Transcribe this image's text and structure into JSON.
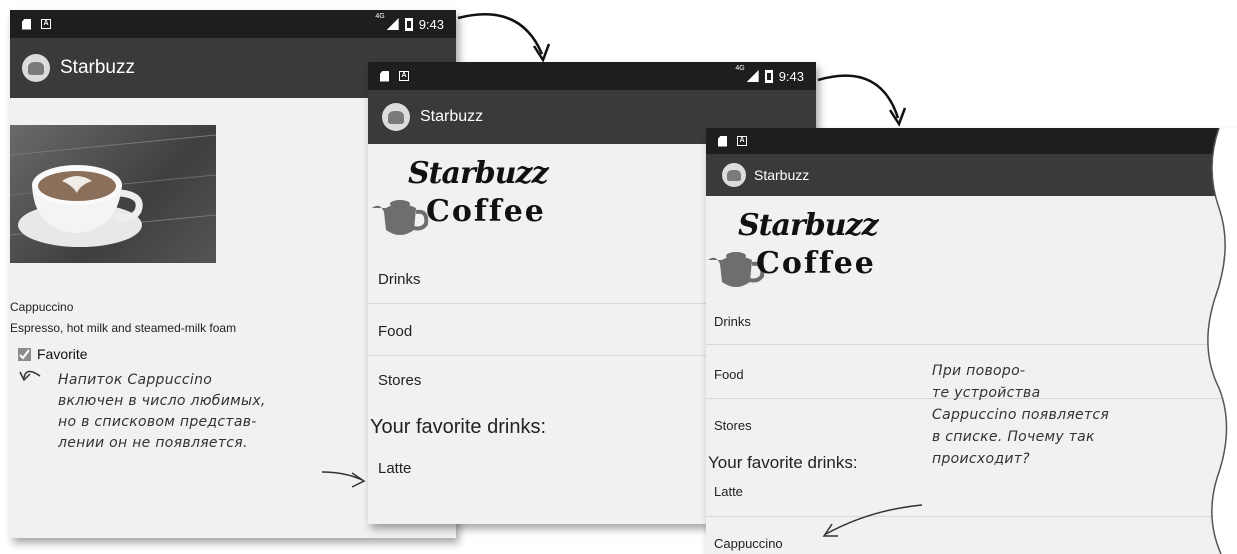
{
  "screens": [
    {
      "status_time": "9:43",
      "network": "4G",
      "app_title": "Starbuzz",
      "drink_name": "Cappuccino",
      "drink_description": "Espresso, hot milk and steamed-milk foam",
      "favorite_label": "Favorite",
      "favorite_checked": true
    },
    {
      "status_time": "9:43",
      "network": "4G",
      "app_title": "Starbuzz",
      "logo_line1": "Starbuzz",
      "logo_line2": "Coffee",
      "menu_items": [
        "Drinks",
        "Food",
        "Stores"
      ],
      "favorites_header": "Your favorite drinks:",
      "favorites": [
        "Latte"
      ]
    },
    {
      "app_title": "Starbuzz",
      "logo_line1": "Starbuzz",
      "logo_line2": "Coffee",
      "menu_items": [
        "Drinks",
        "Food",
        "Stores"
      ],
      "favorites_header": "Your favorite drinks:",
      "favorites": [
        "Latte",
        "Cappuccino"
      ]
    }
  ],
  "annotations": {
    "note1": "Напиток Cappuccino\nвключен в число любимых,\nно в списковом представ-\nлении он не появляется.",
    "note2": "При поворо-\nте устройства\nCappuccino появляется\nв списке. Почему так\nпроисходит?"
  },
  "colors": {
    "statusbar": "#1e1e1e",
    "appbar": "#3a3a3a",
    "screen_bg": "#f1f1f1"
  }
}
